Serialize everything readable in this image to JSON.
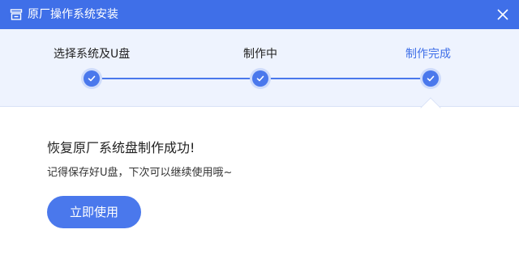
{
  "window": {
    "title": "原厂操作系统安装",
    "accent_color": "#3f6fe8",
    "app_icon": "monitor-icon",
    "close_icon": "close-icon"
  },
  "stepper": {
    "steps": [
      {
        "label": "选择系统及U盘",
        "status": "done",
        "icon": "check-icon"
      },
      {
        "label": "制作中",
        "status": "done",
        "icon": "check-icon"
      },
      {
        "label": "制作完成",
        "status": "current",
        "icon": "check-icon"
      }
    ]
  },
  "main": {
    "heading": "恢复原厂系统盘制作成功!",
    "subtext": "记得保存好U盘，下次可以继续使用哦~",
    "button_label": "立即使用"
  }
}
